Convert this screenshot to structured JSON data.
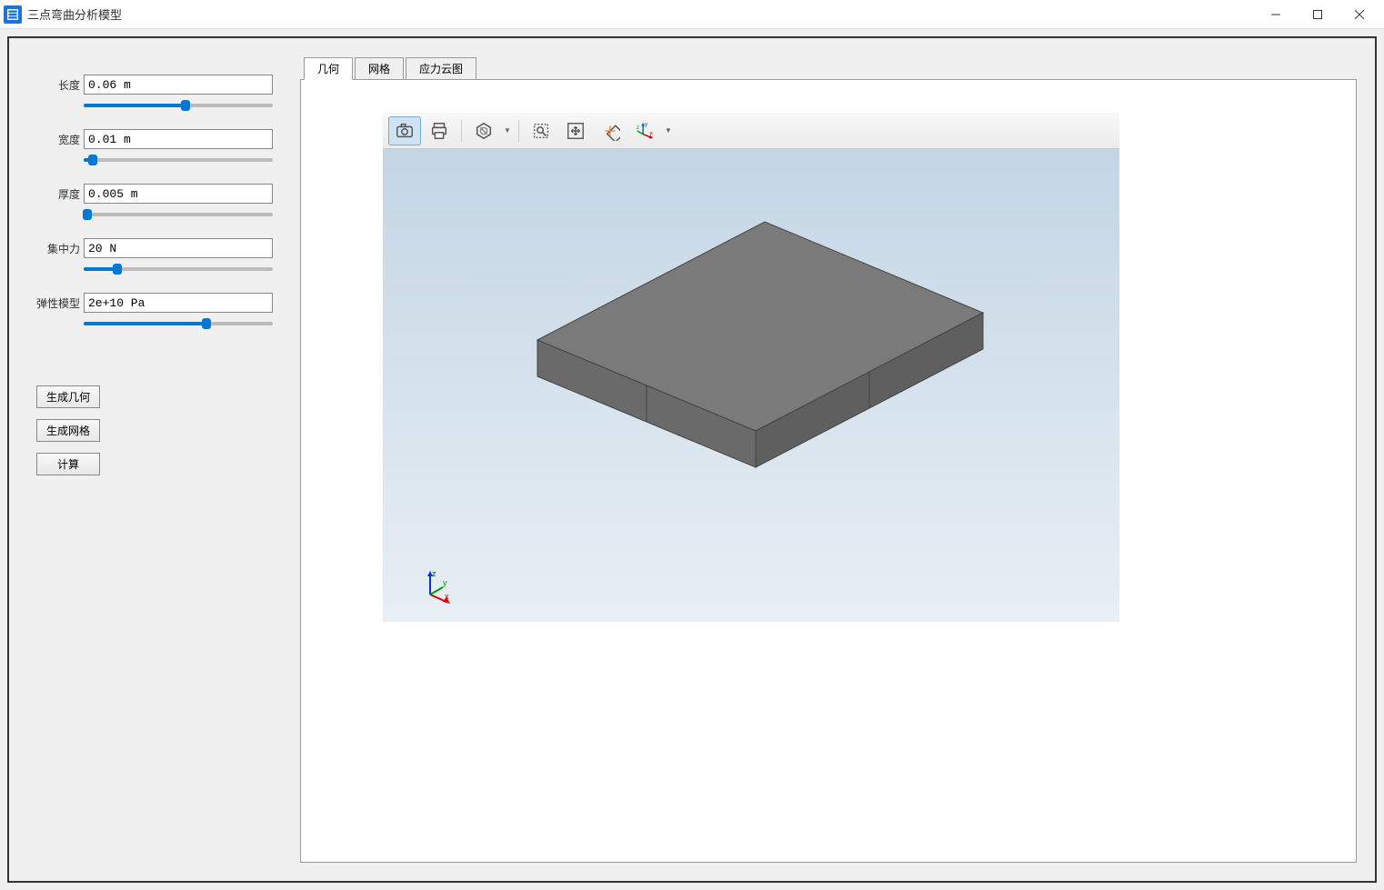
{
  "window": {
    "title": "三点弯曲分析模型"
  },
  "params": {
    "length": {
      "label": "长度",
      "value": "0.06 m",
      "slider_pct": 54
    },
    "width": {
      "label": "宽度",
      "value": "0.01 m",
      "slider_pct": 5
    },
    "thickness": {
      "label": "厚度",
      "value": "0.005 m",
      "slider_pct": 2
    },
    "force": {
      "label": "集中力",
      "value": "20 N",
      "slider_pct": 18
    },
    "modulus": {
      "label": "弹性模型",
      "value": "2e+10 Pa",
      "slider_pct": 65
    }
  },
  "buttons": {
    "gen_geometry": "生成几何",
    "gen_mesh": "生成网格",
    "compute": "计算"
  },
  "tabs": {
    "geometry": "几何",
    "mesh": "网格",
    "stress": "应力云图"
  },
  "axis": {
    "x": "x",
    "y": "y",
    "z": "z"
  }
}
